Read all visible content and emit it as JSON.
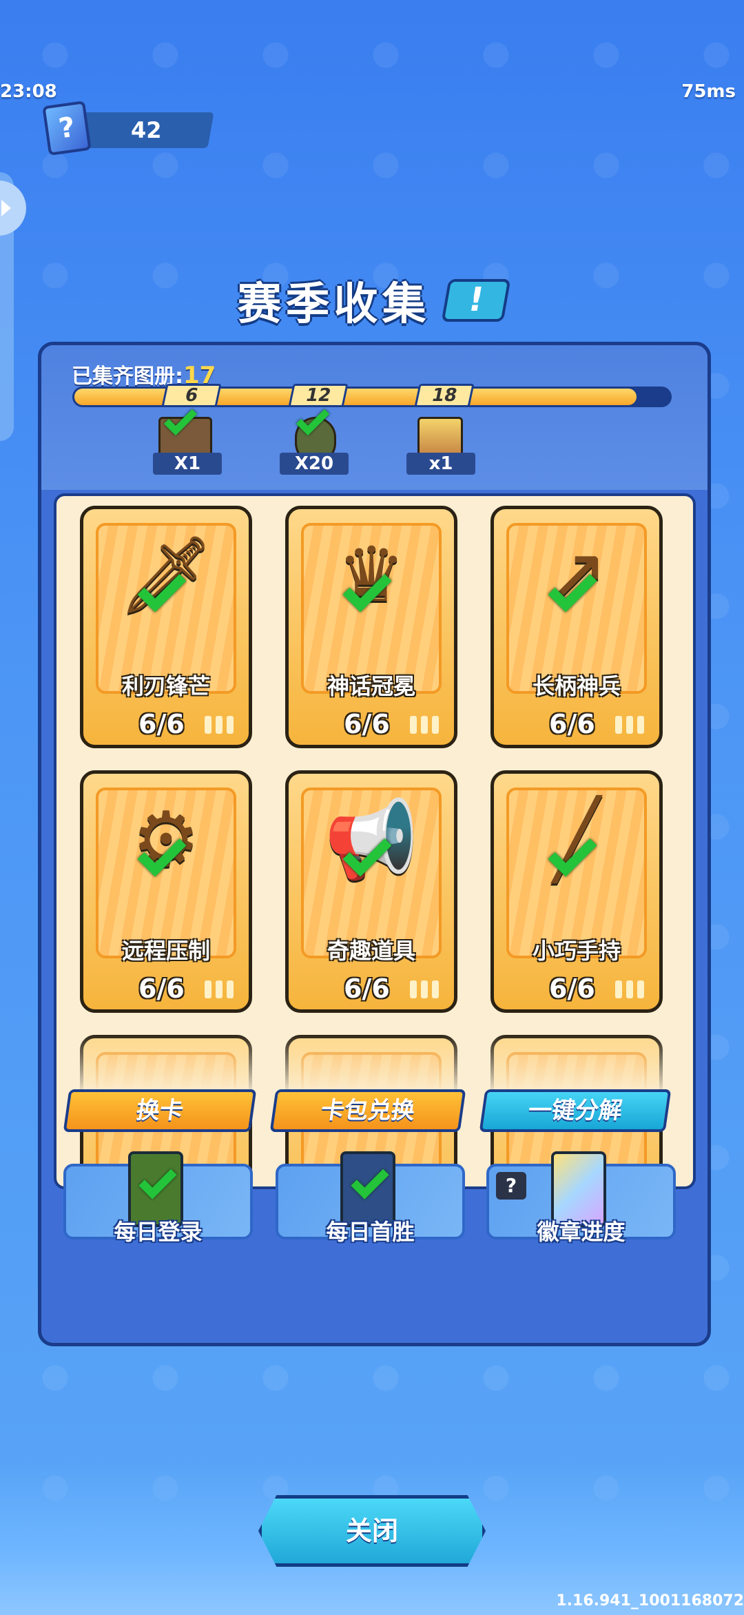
{
  "status": {
    "time": "23:08",
    "ping": "75ms"
  },
  "currency": {
    "icon": "question-card-icon",
    "value": "42"
  },
  "title": "赛季收集",
  "info_button": "!",
  "collection": {
    "label": "已集齐图册:",
    "count": "17",
    "progress": {
      "current": 17,
      "max": 18
    },
    "milestones": [
      {
        "threshold": "6",
        "reward_label": "X1",
        "claimed": true
      },
      {
        "threshold": "12",
        "reward_label": "X20",
        "claimed": true
      },
      {
        "threshold": "18",
        "reward_label": "x1",
        "claimed": false
      }
    ]
  },
  "cards": [
    {
      "name": "利刃锋芒",
      "count": "6/6",
      "icon": "sword-icon",
      "glyph": "🗡"
    },
    {
      "name": "神话冠冕",
      "count": "6/6",
      "icon": "crown-icon",
      "glyph": "♛"
    },
    {
      "name": "长柄神兵",
      "count": "6/6",
      "icon": "spear-icon",
      "glyph": "↗"
    },
    {
      "name": "远程压制",
      "count": "6/6",
      "icon": "blaster-icon",
      "glyph": "⚙"
    },
    {
      "name": "奇趣道具",
      "count": "6/6",
      "icon": "megaphone-icon",
      "glyph": "📢"
    },
    {
      "name": "小巧手持",
      "count": "6/6",
      "icon": "wand-icon",
      "glyph": "╱"
    }
  ],
  "actions": [
    {
      "label": "换卡",
      "color": "orange"
    },
    {
      "label": "卡包兑换",
      "color": "orange"
    },
    {
      "label": "一键分解",
      "color": "cyan"
    }
  ],
  "bonus": [
    {
      "label": "每日登录",
      "color": "#4a7a2e",
      "claimed": true
    },
    {
      "label": "每日首胜",
      "color": "#2d4e86",
      "claimed": true
    },
    {
      "label": "徽章进度",
      "color": "#c9a4f0",
      "claimed": false,
      "badge": "?"
    }
  ],
  "close_button": "关闭",
  "version": "1.16.941_1001168072"
}
